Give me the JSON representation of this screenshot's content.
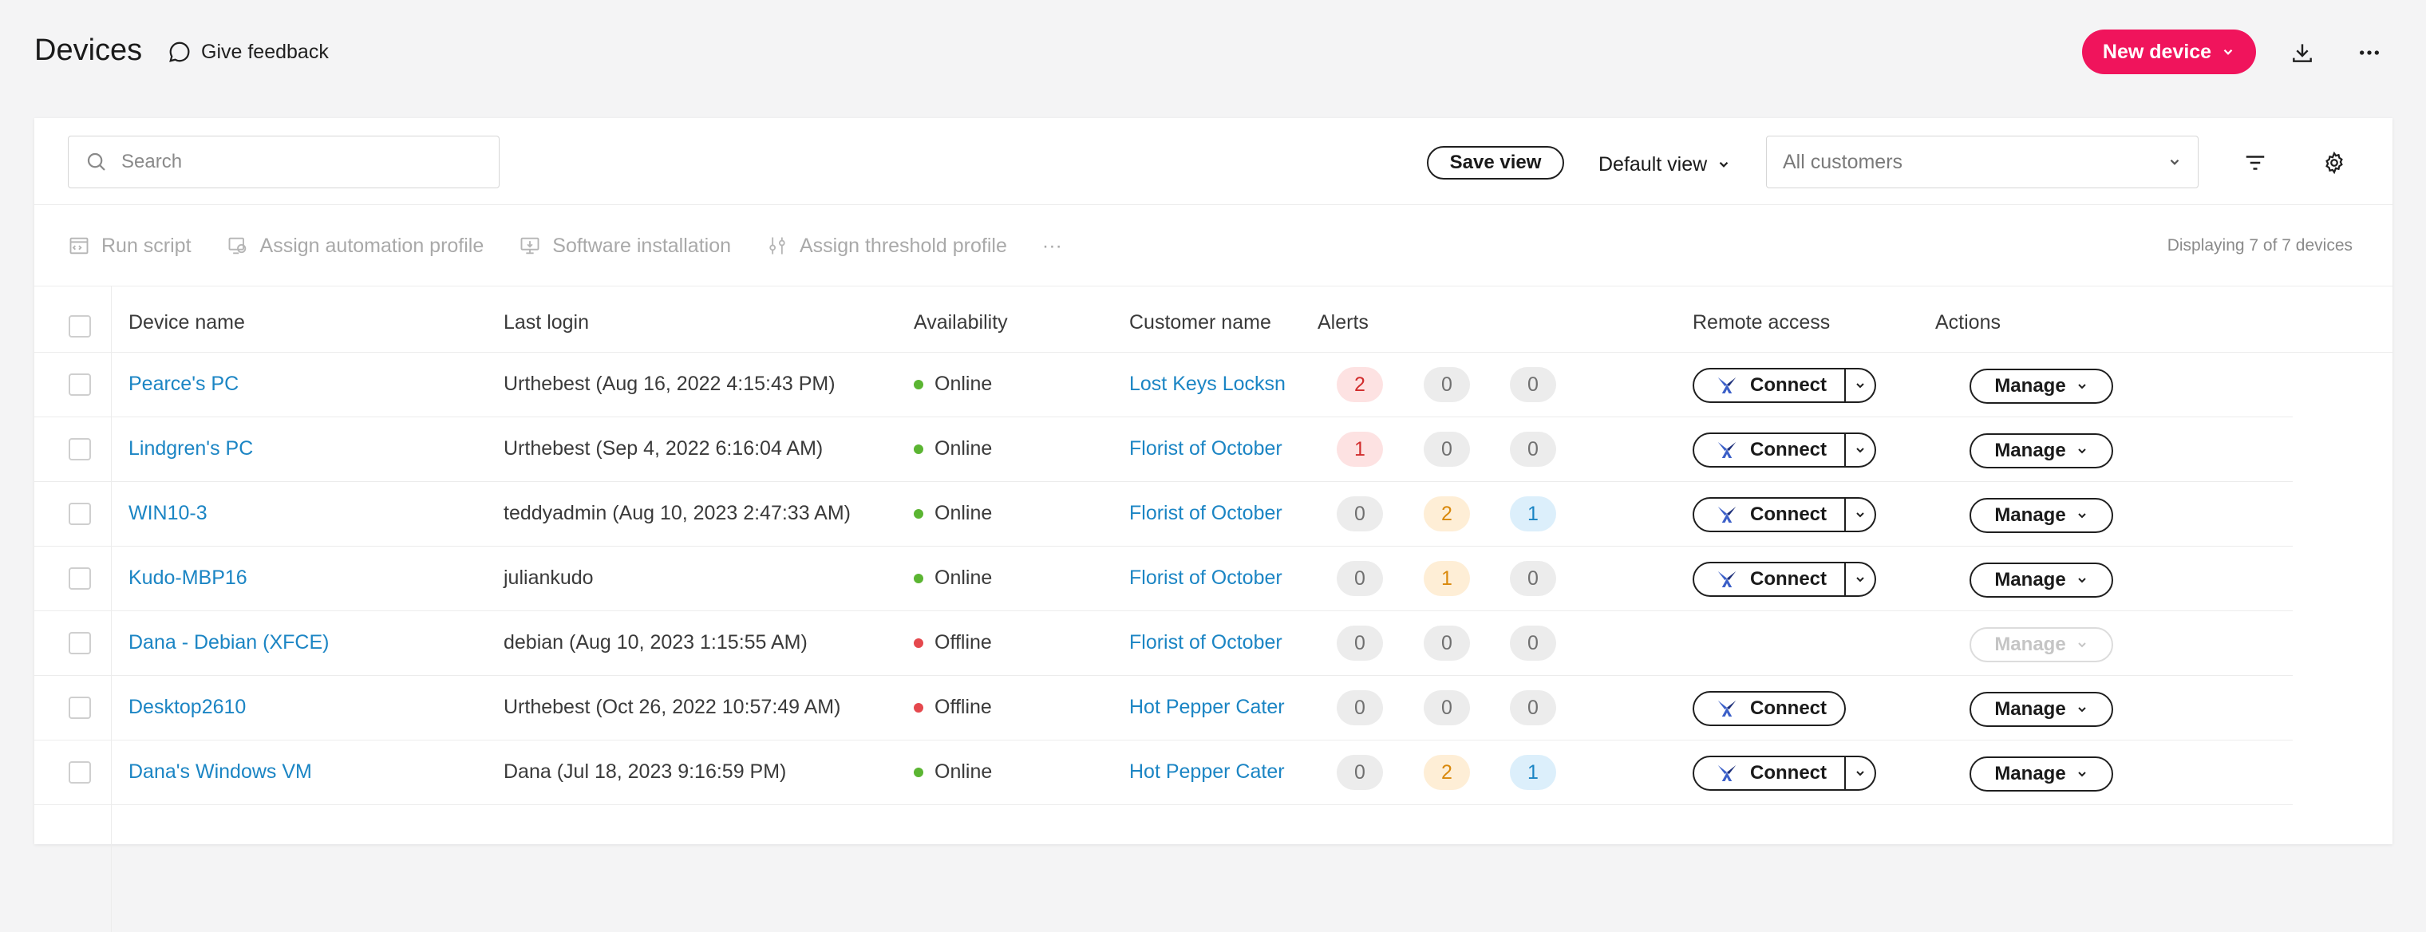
{
  "header": {
    "title": "Devices",
    "feedback_label": "Give feedback",
    "new_device_label": "New device"
  },
  "toolbar": {
    "search_placeholder": "Search",
    "save_view_label": "Save view",
    "default_view_label": "Default view",
    "customers_placeholder": "All customers"
  },
  "bulk_actions": {
    "run_script": "Run script",
    "assign_automation": "Assign automation profile",
    "software_installation": "Software installation",
    "assign_threshold": "Assign threshold profile",
    "more": "···",
    "displaying": "Displaying 7 of 7 devices"
  },
  "columns": {
    "device_name": "Device name",
    "last_login": "Last login",
    "availability": "Availability",
    "customer_name": "Customer name",
    "alerts": "Alerts",
    "remote_access": "Remote access",
    "actions": "Actions"
  },
  "labels": {
    "connect": "Connect",
    "manage": "Manage"
  },
  "colors": {
    "accent": "#f0145c",
    "link": "#1b85c4",
    "online": "#5bb532",
    "offline": "#e5484d",
    "alert_red_bg": "#fde2e2",
    "alert_red_fg": "#d12c2c",
    "alert_orange_bg": "#feeed6",
    "alert_orange_fg": "#d9880b",
    "alert_blue_bg": "#dceffb",
    "alert_blue_fg": "#1b85c4",
    "alert_zero_bg": "#ececec",
    "alert_zero_fg": "#707070"
  },
  "rows": [
    {
      "device": "Pearce's PC",
      "last_login": "Urthebest (Aug 16, 2022 4:15:43 PM)",
      "availability": "Online",
      "customer": "Lost Keys Locksn",
      "alerts": [
        "2",
        "0",
        "0"
      ],
      "remote": "split",
      "manage_enabled": true
    },
    {
      "device": "Lindgren's PC",
      "last_login": "Urthebest (Sep 4, 2022 6:16:04 AM)",
      "availability": "Online",
      "customer": "Florist of October",
      "alerts": [
        "1",
        "0",
        "0"
      ],
      "remote": "split",
      "manage_enabled": true
    },
    {
      "device": "WIN10-3",
      "last_login": "teddyadmin (Aug 10, 2023 2:47:33 AM)",
      "availability": "Online",
      "customer": "Florist of October",
      "alerts": [
        "0",
        "2",
        "1"
      ],
      "remote": "split",
      "manage_enabled": true
    },
    {
      "device": "Kudo-MBP16",
      "last_login": "juliankudo",
      "availability": "Online",
      "customer": "Florist of October",
      "alerts": [
        "0",
        "1",
        "0"
      ],
      "remote": "split",
      "manage_enabled": true
    },
    {
      "device": "Dana - Debian (XFCE)",
      "last_login": "debian (Aug 10, 2023 1:15:55 AM)",
      "availability": "Offline",
      "customer": "Florist of October",
      "alerts": [
        "0",
        "0",
        "0"
      ],
      "remote": "none",
      "manage_enabled": false
    },
    {
      "device": "Desktop2610",
      "last_login": "Urthebest (Oct 26, 2022 10:57:49 AM)",
      "availability": "Offline",
      "customer": "Hot Pepper Cater",
      "alerts": [
        "0",
        "0",
        "0"
      ],
      "remote": "single",
      "manage_enabled": true
    },
    {
      "device": "Dana's Windows VM",
      "last_login": "Dana (Jul 18, 2023 9:16:59 PM)",
      "availability": "Online",
      "customer": "Hot Pepper Cater",
      "alerts": [
        "0",
        "2",
        "1"
      ],
      "remote": "split",
      "manage_enabled": true
    }
  ]
}
